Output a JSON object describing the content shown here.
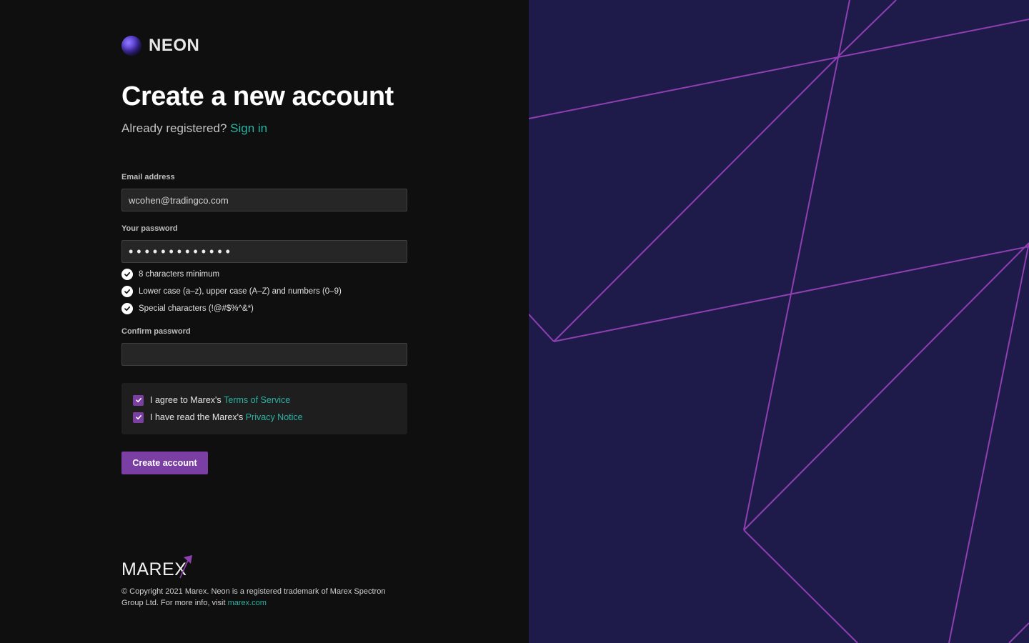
{
  "brand": {
    "name": "NEON",
    "icon": "neon-orb-logo"
  },
  "page": {
    "title": "Create a new account",
    "already_registered": "Already registered?",
    "sign_in": "Sign in"
  },
  "form": {
    "email_label": "Email address",
    "email_value": "wcohen@tradingco.com",
    "password_label": "Your password",
    "password_value": "•••••••••••••",
    "password_rules": [
      "8 characters minimum",
      "Lower case (a–z), upper case (A–Z) and numbers (0–9)",
      "Special characters (!@#$%^&*)"
    ],
    "confirm_label": "Confirm password",
    "confirm_value": ""
  },
  "agreements": {
    "terms_prefix": "I agree to Marex's",
    "terms_link": "Terms of Service",
    "terms_checked": true,
    "privacy_prefix": "I have read the Marex's",
    "privacy_link": "Privacy Notice",
    "privacy_checked": true
  },
  "submit_label": "Create account",
  "footer": {
    "logo_text": "MAREX",
    "copyright": "© Copyright 2021 Marex. Neon is a registered trademark of Marex Spectron Group Ltd. For more info, visit",
    "site_link": "marex.com"
  },
  "colors": {
    "accent": "#7b3ea3",
    "link": "#2bb3a3",
    "panel_bg": "#1e1b4b",
    "line": "#8e3fb0"
  }
}
